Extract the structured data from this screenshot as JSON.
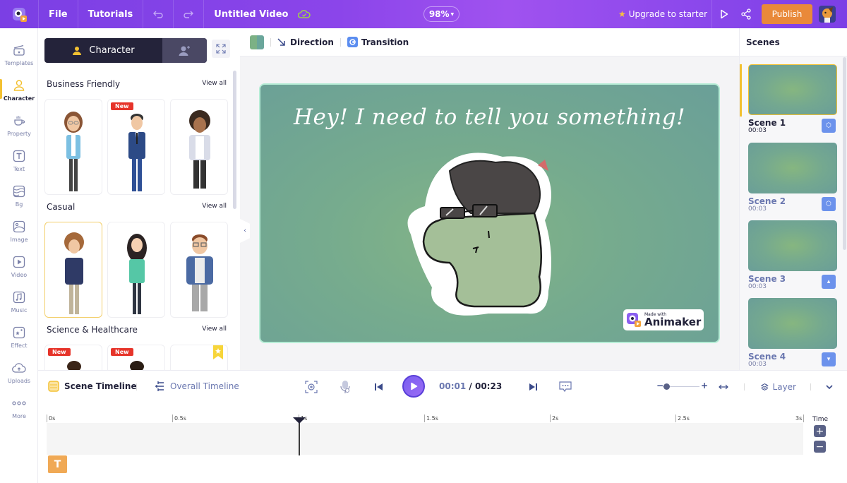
{
  "topbar": {
    "file": "File",
    "tutorials": "Tutorials",
    "project_title": "Untitled Video",
    "zoom": "98%",
    "upgrade": "Upgrade to starter",
    "publish": "Publish",
    "colors": {
      "accent": "#8b45ea",
      "publish": "#e9893a"
    }
  },
  "leftnav": {
    "items": [
      {
        "label": "Templates",
        "icon": "clapperboard-icon"
      },
      {
        "label": "Character",
        "icon": "person-icon",
        "active": true
      },
      {
        "label": "Property",
        "icon": "cup-icon"
      },
      {
        "label": "Text",
        "icon": "text-icon"
      },
      {
        "label": "Bg",
        "icon": "layers-icon"
      },
      {
        "label": "Image",
        "icon": "image-icon"
      },
      {
        "label": "Video",
        "icon": "video-icon"
      },
      {
        "label": "Music",
        "icon": "music-icon"
      },
      {
        "label": "Effect",
        "icon": "effect-icon"
      },
      {
        "label": "Uploads",
        "icon": "cloud-upload-icon"
      },
      {
        "label": "More",
        "icon": "more-icon"
      }
    ]
  },
  "panel": {
    "tab_label": "Character",
    "sections": [
      {
        "title": "Business Friendly",
        "view_all": "View all",
        "cards": [
          {
            "name": "woman-blue-blazer",
            "badge": ""
          },
          {
            "name": "man-navy-suit",
            "badge": "New"
          },
          {
            "name": "woman-grey-cardigan",
            "badge": ""
          }
        ]
      },
      {
        "title": "Casual",
        "view_all": "View all",
        "cards": [
          {
            "name": "curly-hair-man-hoodie",
            "badge": "",
            "selected": true
          },
          {
            "name": "woman-mint-shirt",
            "badge": ""
          },
          {
            "name": "man-denim-jacket",
            "badge": ""
          }
        ]
      },
      {
        "title": "Science & Healthcare",
        "view_all": "View all",
        "cards": [
          {
            "name": "healthcare-char-1",
            "badge": "New"
          },
          {
            "name": "healthcare-char-2",
            "badge": "New"
          },
          {
            "name": "healthcare-char-3",
            "badge": "premium"
          }
        ]
      }
    ]
  },
  "canvasbar": {
    "direction": "Direction",
    "transition": "Transition"
  },
  "stage": {
    "caption": "Hey! I need to tell you something!",
    "watermark_small": "Made with",
    "watermark_big": "Animaker"
  },
  "scenes": {
    "title": "Scenes",
    "items": [
      {
        "name": "Scene 1",
        "duration": "00:03",
        "active": true
      },
      {
        "name": "Scene 2",
        "duration": "00:03"
      },
      {
        "name": "Scene 3",
        "duration": "00:03"
      },
      {
        "name": "Scene 4",
        "duration": "00:03"
      }
    ]
  },
  "timeline": {
    "scene_tab": "Scene Timeline",
    "overall_tab": "Overall Timeline",
    "current_time": "00:01",
    "separator": "/",
    "total_time": "00:23",
    "layer": "Layer",
    "time_label": "Time",
    "ticks": [
      "0s",
      "0.5s",
      "1s",
      "1.5s",
      "2s",
      "2.5s",
      "3s"
    ],
    "text_layer_glyph": "T"
  }
}
